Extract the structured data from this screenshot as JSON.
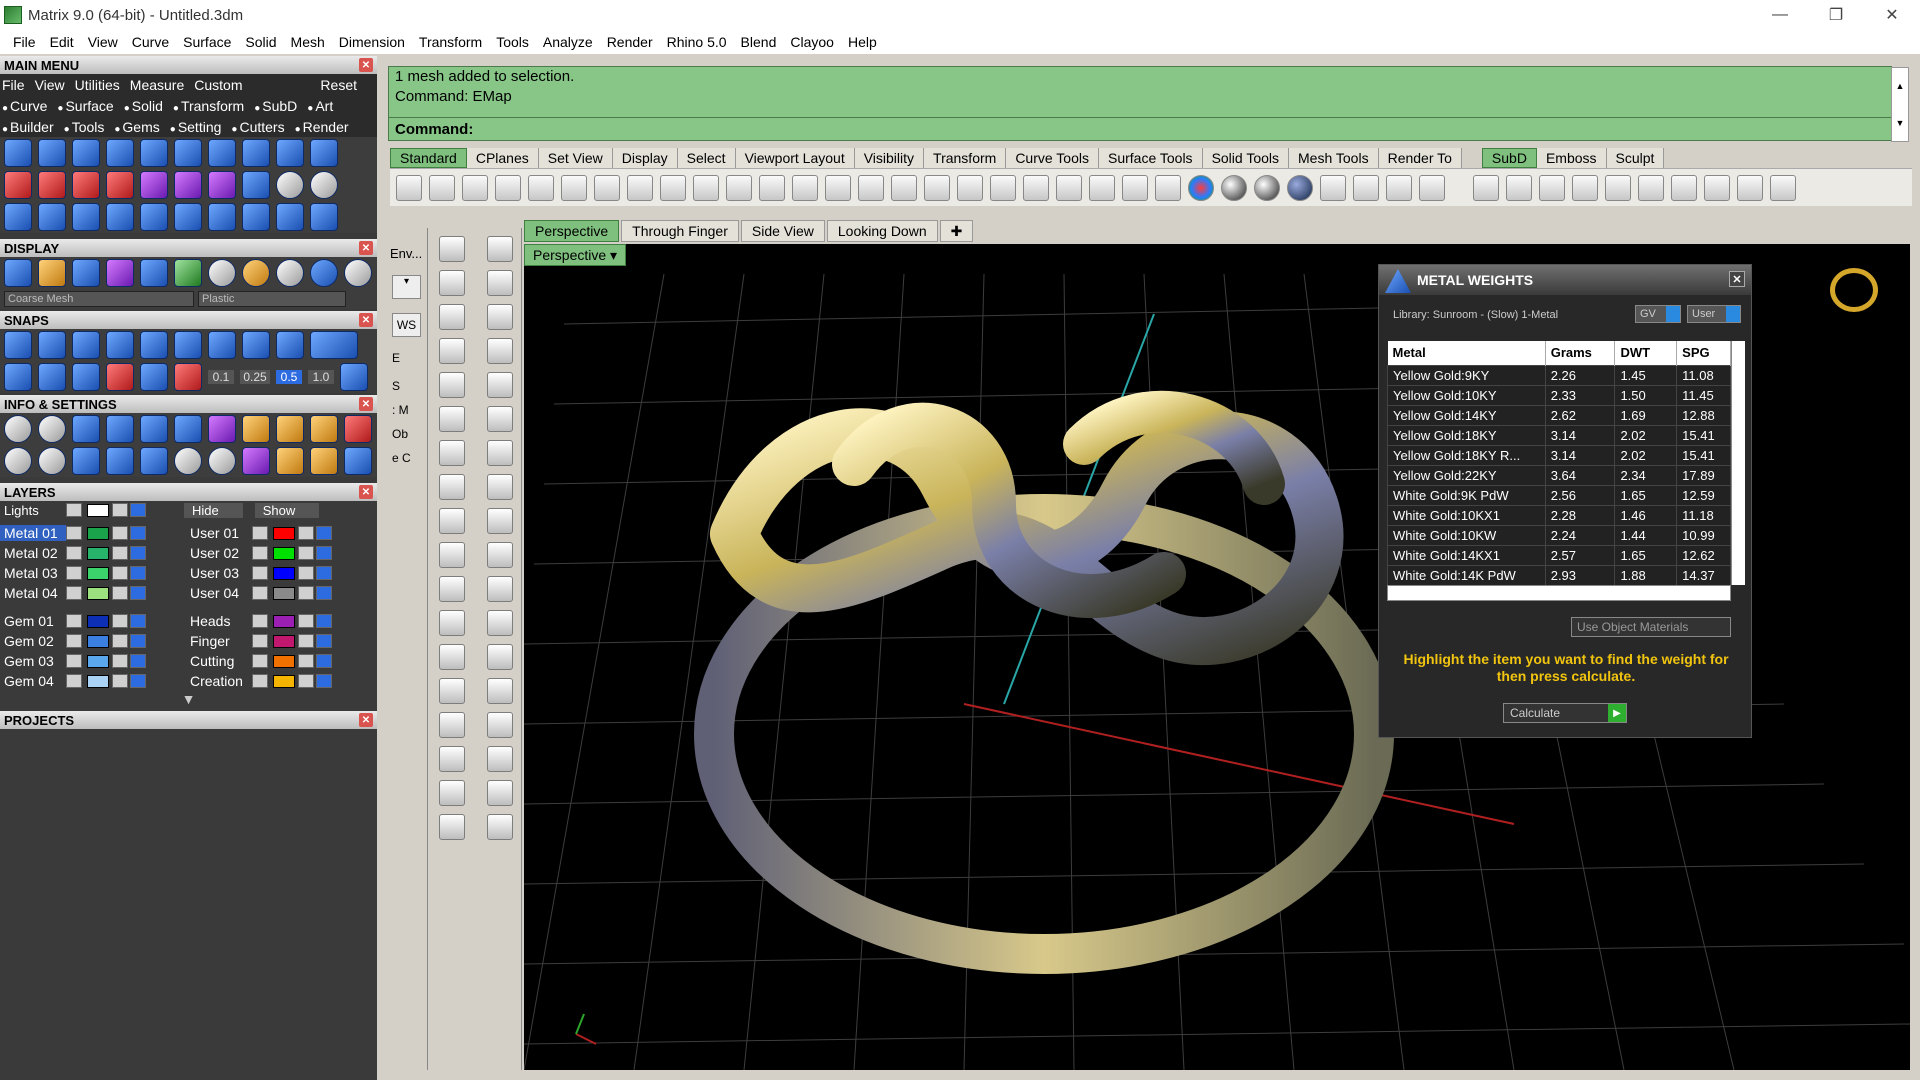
{
  "window": {
    "title": "Matrix 9.0 (64-bit) - Untitled.3dm",
    "minimize": "—",
    "restore": "❐",
    "close": "✕"
  },
  "menu": [
    "File",
    "Edit",
    "View",
    "Curve",
    "Surface",
    "Solid",
    "Mesh",
    "Dimension",
    "Transform",
    "Tools",
    "Analyze",
    "Render",
    "Rhino 5.0",
    "Blend",
    "Clayoo",
    "Help"
  ],
  "main_menu": {
    "title": "MAIN MENU",
    "row1": [
      "File",
      "View",
      "Utilities",
      "Measure",
      "Custom"
    ],
    "reset": "Reset",
    "row2": [
      "Curve",
      "Surface",
      "Solid",
      "Transform",
      "SubD",
      "Art"
    ],
    "row3": [
      "Builder",
      "Tools",
      "Gems",
      "Setting",
      "Cutters",
      "Render"
    ]
  },
  "display": {
    "title": "DISPLAY",
    "mesh_select": "Coarse Mesh",
    "material_select": "Plastic"
  },
  "snaps": {
    "title": "SNAPS",
    "values": [
      "0.1",
      "0.25",
      "0.5",
      "1.0"
    ]
  },
  "info_settings": {
    "title": "INFO & SETTINGS"
  },
  "layers": {
    "title": "LAYERS",
    "lights": "Lights",
    "hide": "Hide",
    "show": "Show",
    "left": [
      {
        "name": "Metal 01",
        "color": "#1aa34a",
        "active": true
      },
      {
        "name": "Metal 02",
        "color": "#27b36a"
      },
      {
        "name": "Metal 03",
        "color": "#3cd26b"
      },
      {
        "name": "Metal 04",
        "color": "#9de07f"
      },
      {
        "name": "Gem 01",
        "color": "#0d2fb5"
      },
      {
        "name": "Gem 02",
        "color": "#3b7fe0"
      },
      {
        "name": "Gem 03",
        "color": "#5aa7ee"
      },
      {
        "name": "Gem 04",
        "color": "#a9d2f5"
      }
    ],
    "right": [
      {
        "name": "User 01",
        "color": "#ff0000"
      },
      {
        "name": "User 02",
        "color": "#00e000"
      },
      {
        "name": "User 03",
        "color": "#0000ff"
      },
      {
        "name": "User 04",
        "color": "#8a8a8a"
      },
      {
        "name": "Heads",
        "color": "#9b1fb3"
      },
      {
        "name": "Finger",
        "color": "#c0176f"
      },
      {
        "name": "Cutting",
        "color": "#f07000"
      },
      {
        "name": "Creation",
        "color": "#f5b400"
      }
    ]
  },
  "projects": {
    "title": "PROJECTS"
  },
  "command": {
    "line1": "1 mesh added to selection.",
    "line2": "Command: EMap",
    "prompt": "Command:"
  },
  "toolbar_tabs": [
    "Standard",
    "CPlanes",
    "Set View",
    "Display",
    "Select",
    "Viewport Layout",
    "Visibility",
    "Transform",
    "Curve Tools",
    "Surface Tools",
    "Solid Tools",
    "Mesh Tools",
    "Render To"
  ],
  "toolbar_tabs_right": [
    "SubD",
    "Emboss",
    "Sculpt"
  ],
  "env_label": "Env...",
  "env_items": [
    "WS",
    "E",
    "S",
    ": M",
    "Ob",
    "e C"
  ],
  "viewport_tabs": [
    "Perspective",
    "Through Finger",
    "Side View",
    "Looking Down"
  ],
  "viewport_label": "Perspective",
  "metal_weights": {
    "title": "METAL WEIGHTS",
    "library": "Library: Sunroom - (Slow) 1-Metal",
    "gv": "GV",
    "user": "User",
    "columns": [
      "Metal",
      "Grams",
      "DWT",
      "SPG"
    ],
    "rows": [
      [
        "Yellow Gold:9KY",
        "2.26",
        "1.45",
        "11.08"
      ],
      [
        "Yellow Gold:10KY",
        "2.33",
        "1.50",
        "11.45"
      ],
      [
        "Yellow Gold:14KY",
        "2.62",
        "1.69",
        "12.88"
      ],
      [
        "Yellow Gold:18KY",
        "3.14",
        "2.02",
        "15.41"
      ],
      [
        "Yellow Gold:18KY R...",
        "3.14",
        "2.02",
        "15.41"
      ],
      [
        "Yellow Gold:22KY",
        "3.64",
        "2.34",
        "17.89"
      ],
      [
        "White Gold:9K PdW",
        "2.56",
        "1.65",
        "12.59"
      ],
      [
        "White Gold:10KX1",
        "2.28",
        "1.46",
        "11.18"
      ],
      [
        "White Gold:10KW",
        "2.24",
        "1.44",
        "10.99"
      ],
      [
        "White Gold:14KX1",
        "2.57",
        "1.65",
        "12.62"
      ],
      [
        "White Gold:14K PdW",
        "2.93",
        "1.88",
        "14.37"
      ]
    ],
    "use_object_materials": "Use Object Materials",
    "message": "Highlight the item you want to find the weight for then press calculate.",
    "calculate": "Calculate"
  }
}
